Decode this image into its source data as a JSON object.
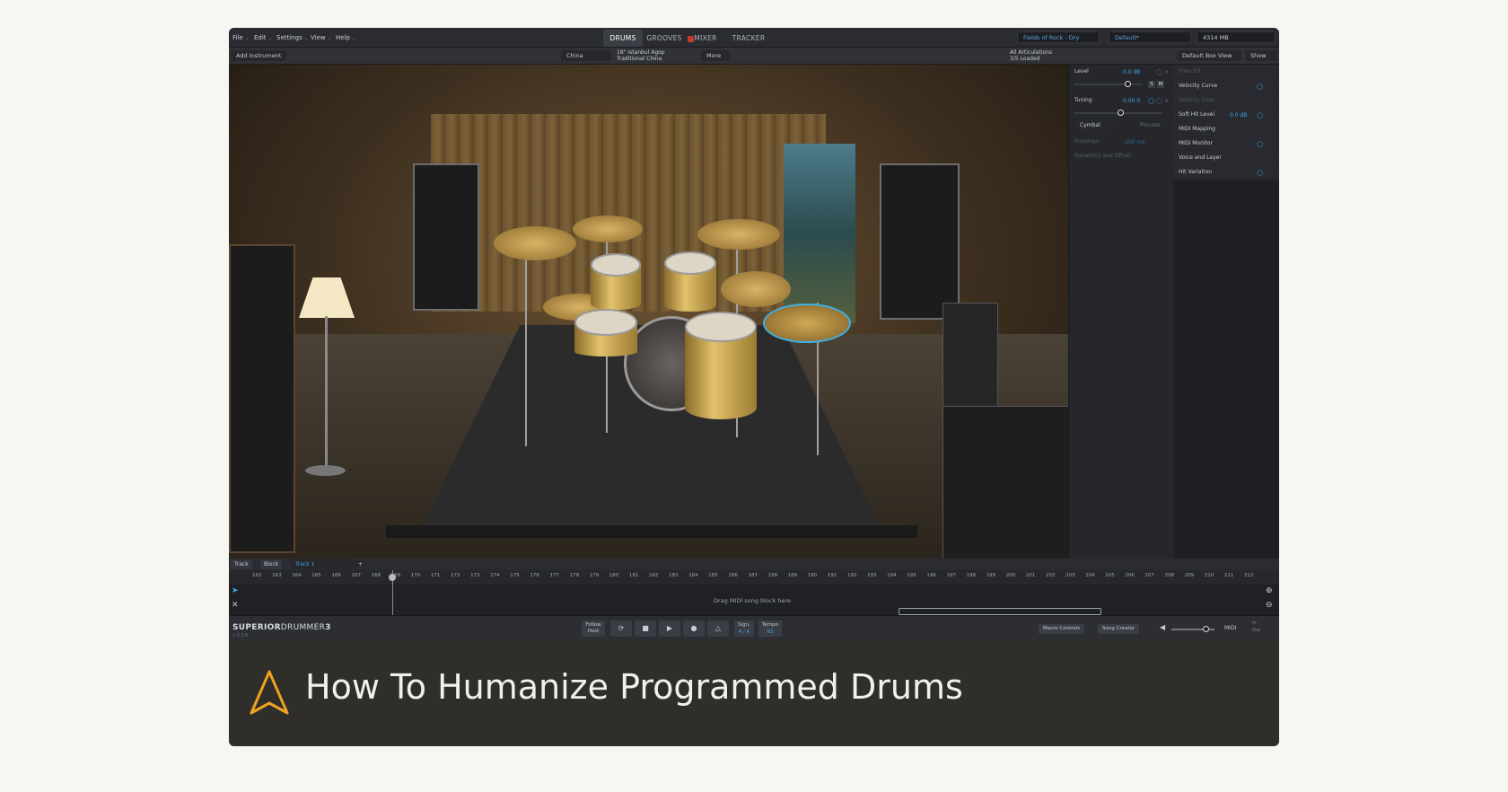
{
  "menu": [
    "File",
    "Edit",
    "Settings",
    "View",
    "Help"
  ],
  "tabs": {
    "drums": "DRUMS",
    "grooves": "GROOVES",
    "mixer": "MIXER",
    "tracker": "TRACKER",
    "badge": "M"
  },
  "presets": {
    "kit": "Fields of Rock - Dry",
    "mix": "Default*",
    "memory": "4314 MB"
  },
  "toolbar": {
    "add_instrument": "Add Instrument",
    "instrument": "China",
    "articulation_line1": "18\" Istanbul Agop",
    "articulation_line2": "Traditional China",
    "more": "More",
    "loaded_line1": "All Articulations",
    "loaded_line2": "3/5 Loaded",
    "view": "Default Box View",
    "show": "Show"
  },
  "inst_panel": {
    "level_label": "Level",
    "level_value": "0.0 dB",
    "tuning_label": "Tuning",
    "tuning_value": "0.00 0",
    "type": "Cymbal",
    "process": "Process",
    "envelope_label": "Envelope",
    "envelope_value": "200 ms",
    "dynamics": "Dynamics and Offset",
    "solo": "S",
    "mute": "M"
  },
  "settings_panel": [
    "Flam Fill",
    "Velocity Curve",
    "Velocity Gate",
    "Soft Hit Level",
    "MIDI Mapping",
    "MIDI Monitor",
    "Voice and Layer",
    "Hit Variation"
  ],
  "soft_hit_value": "0.0 dB",
  "track": {
    "track": "Track",
    "block": "Block",
    "track1": "Track 1",
    "add": "+",
    "hint": "Drag MIDI song block here"
  },
  "ruler": [
    "162",
    "163",
    "164",
    "165",
    "166",
    "167",
    "168",
    "169",
    "170",
    "171",
    "172",
    "173",
    "174",
    "175",
    "176",
    "177",
    "178",
    "179",
    "180",
    "181",
    "182",
    "183",
    "184",
    "185",
    "186",
    "187",
    "188",
    "189",
    "190",
    "191",
    "192",
    "193",
    "194",
    "195",
    "196",
    "197",
    "198",
    "199",
    "200",
    "201",
    "202",
    "203",
    "204",
    "205",
    "206",
    "207",
    "208",
    "209",
    "210",
    "211",
    "212"
  ],
  "bottom": {
    "logo_a": "SUPERIOR",
    "logo_b": "DRUMMER",
    "logo_c": "3",
    "version": "v 3.3.6",
    "follow": "Follow Host",
    "sign_label": "Sign.",
    "sign_value": "4 / 4",
    "tempo_label": "Tempo",
    "tempo_value": "83",
    "macro": "Macro Controls",
    "song": "Song Creator",
    "midi": "MIDI",
    "in": "In",
    "out": "Out"
  },
  "caption": "How To Humanize Programmed Drums",
  "colors": {
    "accent": "#3ea6e8",
    "caption_bg": "#2f2e2a",
    "logo_orange": "#f0a320",
    "page_bg": "#f7f6f3"
  }
}
